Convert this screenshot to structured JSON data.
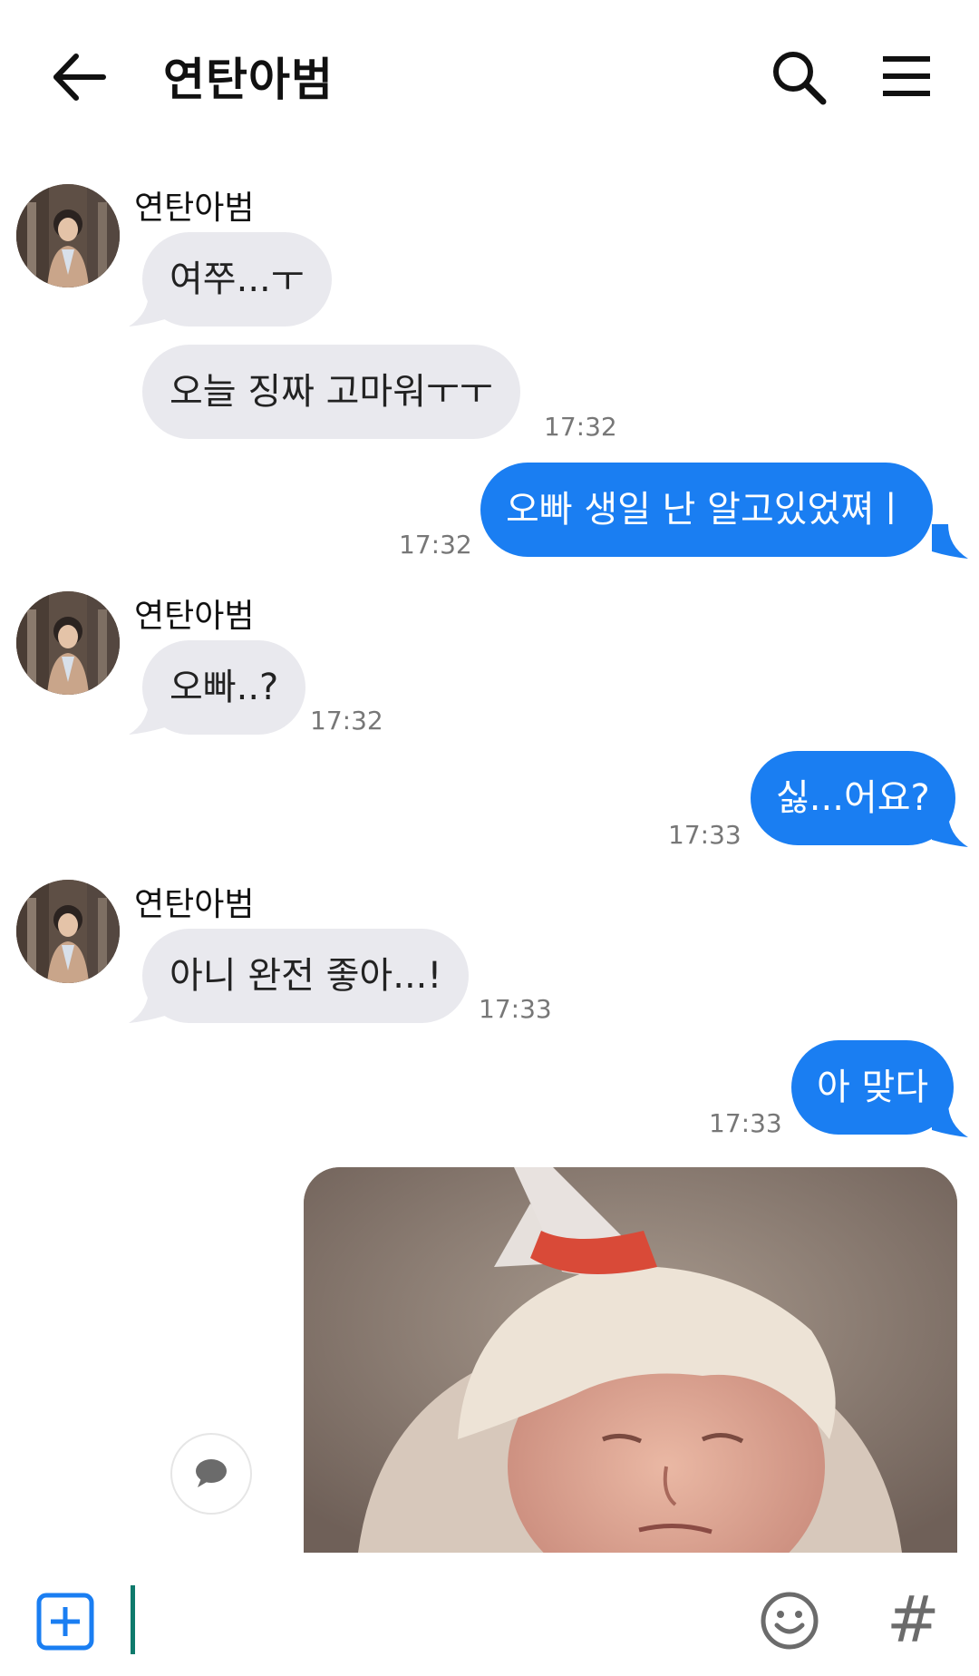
{
  "header": {
    "title": "연탄아범"
  },
  "contact_name": "연탄아범",
  "messages": [
    {
      "side": "in",
      "text": "여쭈...ㅜ"
    },
    {
      "side": "in",
      "text": "오늘 징짜 고마워ㅜㅜ",
      "time": "17:32"
    },
    {
      "side": "out",
      "text": "오빠 생일 난 알고있었쪄ㅣ",
      "time": "17:32"
    },
    {
      "side": "in",
      "text": "오빠..?",
      "time": "17:32"
    },
    {
      "side": "out",
      "text": "싫...어요?",
      "time": "17:33"
    },
    {
      "side": "in",
      "text": "아니 완전 좋아...!",
      "time": "17:33"
    },
    {
      "side": "out",
      "text": "아 맞다",
      "time": "17:33"
    }
  ],
  "colors": {
    "incoming_bubble": "#e9e9ee",
    "outgoing_bubble": "#1a7ef2",
    "cursor": "#0f7a6c"
  },
  "icons": [
    "back-arrow-icon",
    "search-icon",
    "menu-icon",
    "chat-icon",
    "plus-icon",
    "emoji-icon",
    "hash-icon"
  ],
  "input": {
    "placeholder": ""
  },
  "hash_symbol": "#"
}
